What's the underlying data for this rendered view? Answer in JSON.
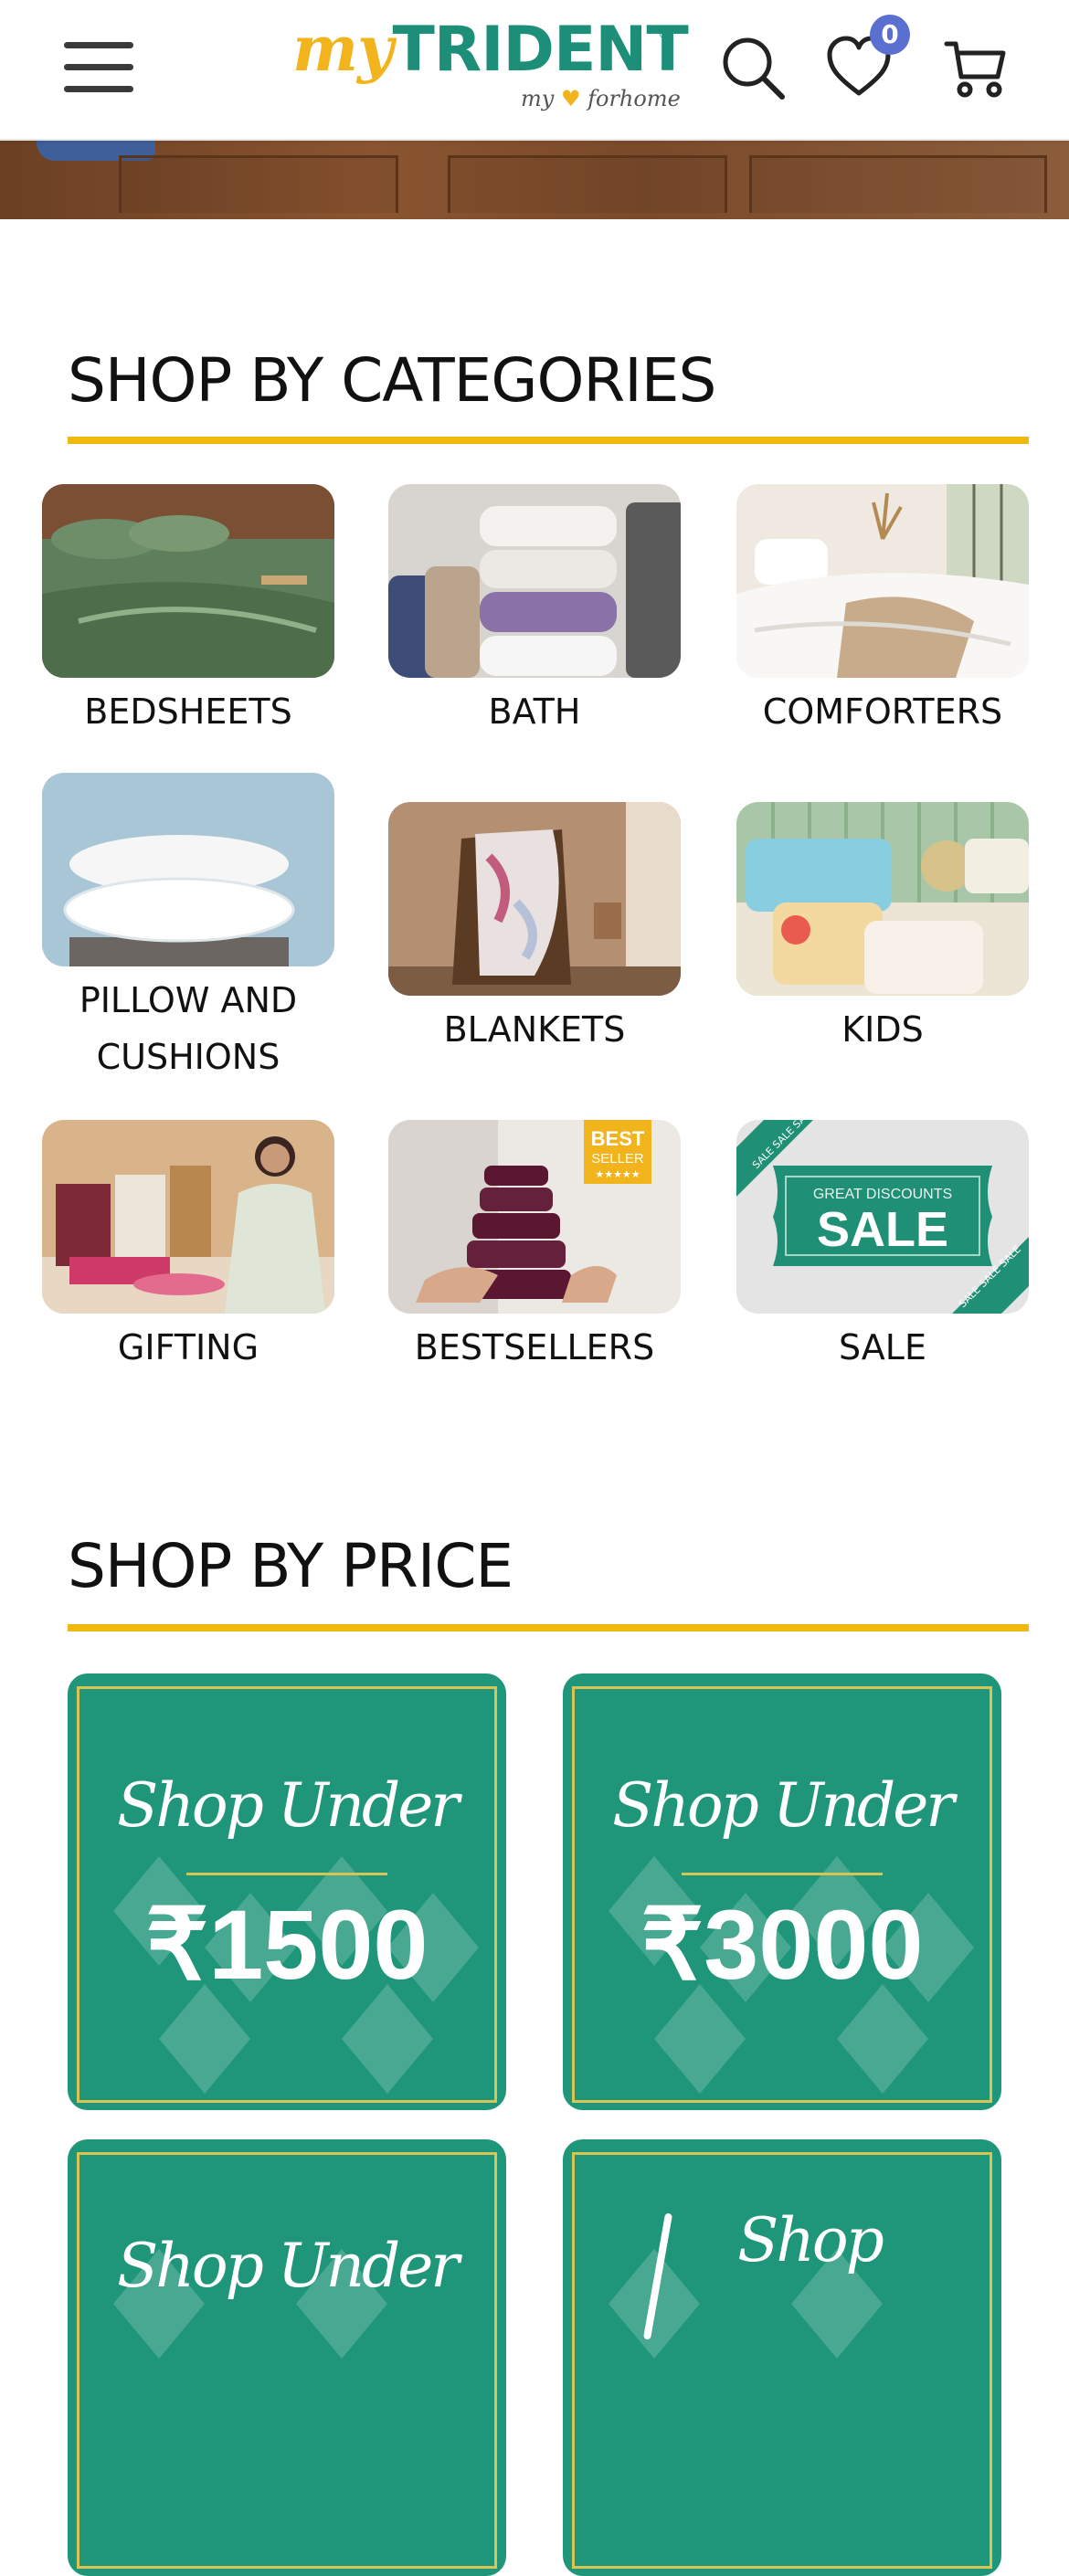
{
  "header": {
    "logo_my": "my",
    "logo_brand": "TRIDENT",
    "logo_reg": "®",
    "logo_tag_left": "my",
    "logo_tag_right": "forhome",
    "wishlist_count": "0",
    "icons": [
      "menu-icon",
      "search-icon",
      "heart-icon",
      "cart-icon"
    ]
  },
  "categories_section": {
    "title": "SHOP BY CATEGORIES",
    "items": [
      {
        "label": "BEDSHEETS"
      },
      {
        "label": "BATH"
      },
      {
        "label": "COMFORTERS"
      },
      {
        "label": "PILLOW AND CUSHIONS"
      },
      {
        "label": "BLANKETS"
      },
      {
        "label": "KIDS"
      },
      {
        "label": "GIFTING"
      },
      {
        "label": "BESTSELLERS",
        "badge_line1": "BEST",
        "badge_line2": "SELLER",
        "badge_stars": "★★★★★"
      },
      {
        "label": "SALE",
        "sale_small": "GREAT DISCOUNTS",
        "sale_big": "SALE",
        "ribbon": "SALE SALE SALE"
      }
    ]
  },
  "price_section": {
    "title": "SHOP BY PRICE",
    "cards": [
      {
        "script": "Shop Under",
        "amount": "₹1500"
      },
      {
        "script": "Shop Under",
        "amount": "₹3000"
      },
      {
        "script": "Shop Under"
      },
      {
        "script": "Shop"
      }
    ]
  },
  "colors": {
    "accent_yellow": "#f1b80f",
    "brand_green": "#1d8f78",
    "price_card_green": "#1f9579",
    "badge_blue": "#5b6fd1"
  }
}
